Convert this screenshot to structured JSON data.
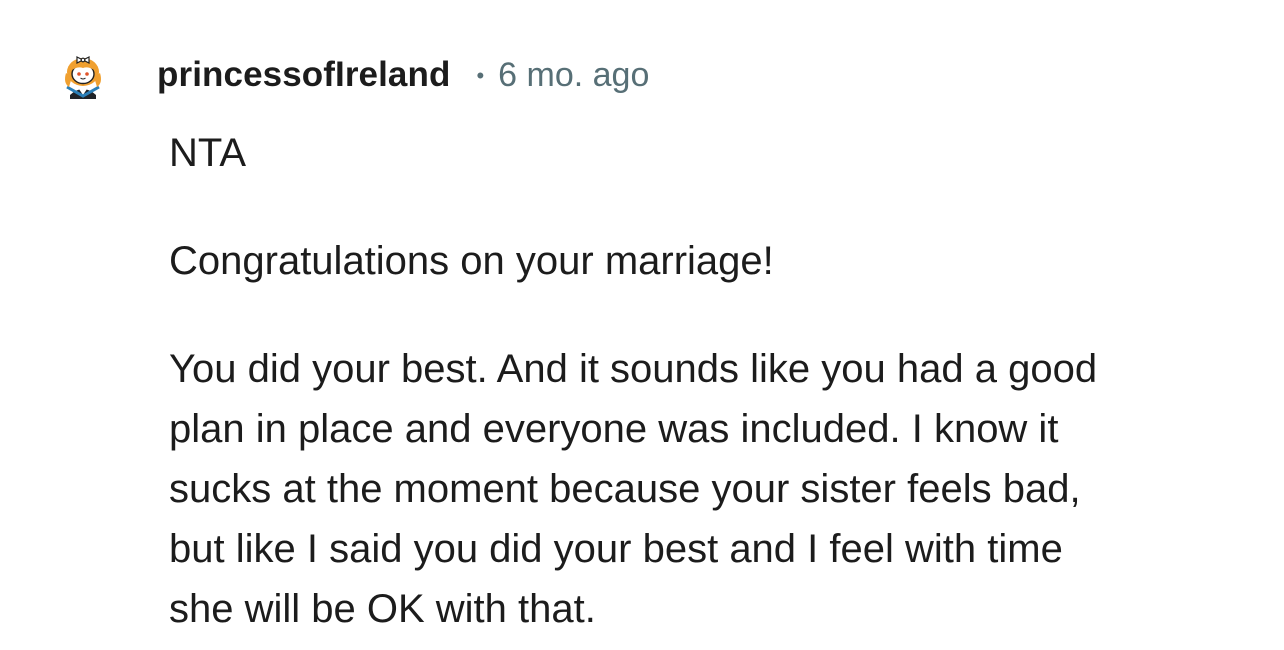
{
  "comment": {
    "author": "princessofIreland",
    "separator": "•",
    "timestamp": "6 mo. ago",
    "avatar_icon": "snoo-avatar-icon",
    "paragraphs": [
      [
        "NTA"
      ],
      [
        "Congratulations on your marriage!"
      ],
      [
        "You did your best. And it sounds like you had a good",
        "plan in place and everyone was included. I know it",
        "sucks at the moment because your sister feels bad,",
        "but like I said you did your best and I feel with time",
        "she will be OK with that."
      ]
    ]
  }
}
